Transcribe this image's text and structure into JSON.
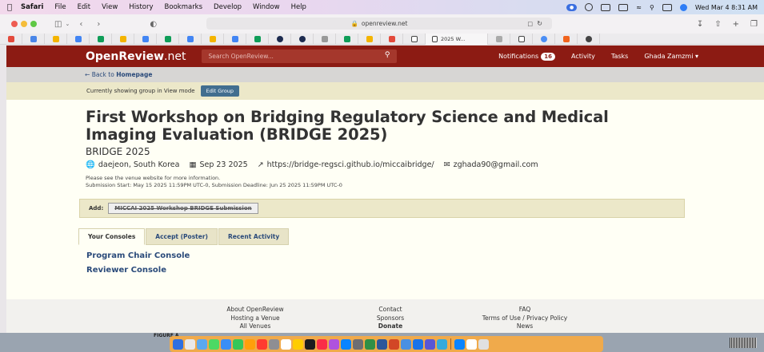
{
  "menubar": {
    "app": "Safari",
    "items": [
      "File",
      "Edit",
      "View",
      "History",
      "Bookmarks",
      "Develop",
      "Window",
      "Help"
    ],
    "clock": "Wed Mar 4  8:31 AM"
  },
  "toolbar": {
    "url": "openreview.net"
  },
  "favorites": {
    "active_tab_label": "2025 W..."
  },
  "header": {
    "logo_main": "OpenReview",
    "logo_suffix": ".net",
    "search_placeholder": "Search OpenReview...",
    "notifications_label": "Notifications",
    "notifications_count": "16",
    "activity": "Activity",
    "tasks": "Tasks",
    "user": "Ghada Zamzmi"
  },
  "backbar": {
    "prefix": "Back to",
    "link": "Homepage"
  },
  "modebar": {
    "text": "Currently showing group in View mode",
    "edit_button": "Edit Group"
  },
  "venue": {
    "title_line1": "First Workshop on Bridging Regulatory Science and Medical",
    "title_line2": "Imaging Evaluation (BRIDGE 2025)",
    "subtitle": "BRIDGE 2025",
    "location": "daejeon, South Korea",
    "date": "Sep 23 2025",
    "website": "https://bridge-regsci.github.io/miccaibridge/",
    "email": "zghada90@gmail.com",
    "desc_line1": "Please see the venue website for more information.",
    "desc_line2": "Submission Start: May 15 2025 11:59PM UTC-0, Submission Deadline: Jun 25 2025 11:59PM UTC-0"
  },
  "add": {
    "label": "Add:",
    "button": "MICCAI 2025 Workshop BRIDGE Submission"
  },
  "tabs": [
    "Your Consoles",
    "Accept (Poster)",
    "Recent Activity"
  ],
  "consoles": [
    "Program Chair Console",
    "Reviewer Console"
  ],
  "footer": {
    "col1": [
      "About OpenReview",
      "Hosting a Venue",
      "All Venues"
    ],
    "col2": [
      "Contact",
      "Sponsors",
      "Donate"
    ],
    "col3": [
      "FAQ",
      "Terms of Use / Privacy Policy",
      "News"
    ]
  },
  "desktop_label": "FIGURE A",
  "colors": {
    "brand_red": "#8c1b13",
    "link_blue": "#2a4a7a",
    "mode_bar": "#ece8c9",
    "page_bg": "#fffff5",
    "dock": "#f4ab46"
  }
}
